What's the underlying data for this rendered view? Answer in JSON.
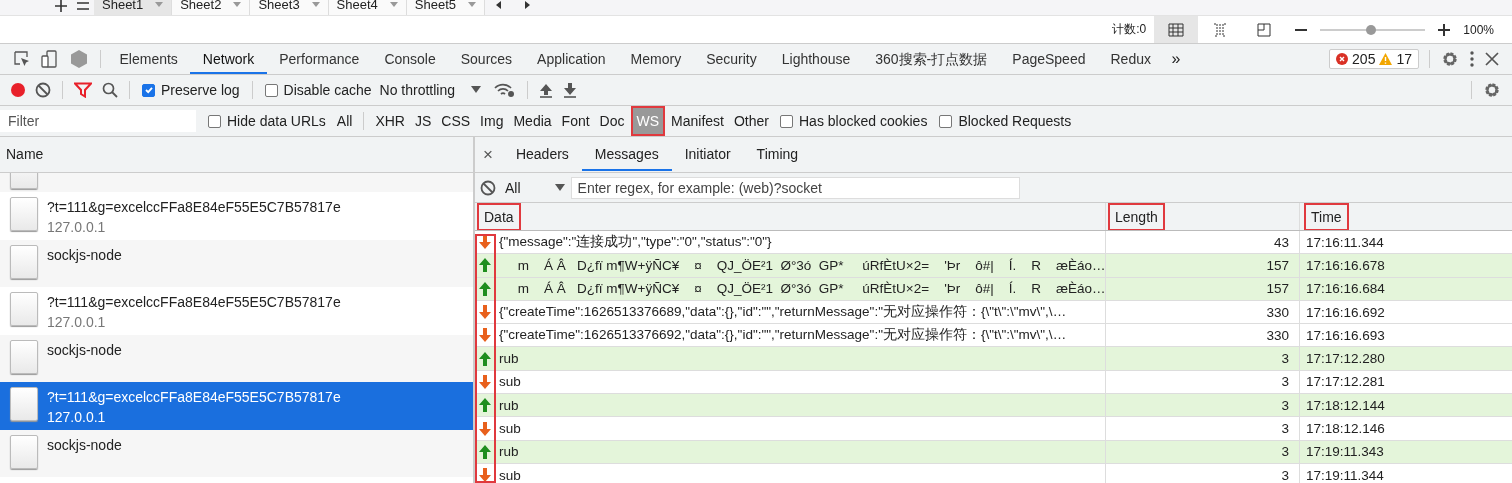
{
  "spreadsheet": {
    "sheet_tabs": [
      {
        "label": "Sheet1",
        "selected": true
      },
      {
        "label": "Sheet2",
        "selected": false
      },
      {
        "label": "Sheet3",
        "selected": false
      },
      {
        "label": "Sheet4",
        "selected": false
      },
      {
        "label": "Sheet5",
        "selected": false
      }
    ],
    "count": "计数:0",
    "views": [
      {
        "selected": true
      },
      {
        "selected": false
      },
      {
        "selected": false
      }
    ],
    "zoom": {
      "level": 0.48,
      "reading": "100%"
    }
  },
  "devtools": {
    "tabs": [
      {
        "label": "Elements",
        "selected": false
      },
      {
        "label": "Network",
        "selected": true
      },
      {
        "label": "Performance",
        "selected": false
      },
      {
        "label": "Console",
        "selected": false
      },
      {
        "label": "Sources",
        "selected": false
      },
      {
        "label": "Application",
        "selected": false
      },
      {
        "label": "Memory",
        "selected": false
      },
      {
        "label": "Security",
        "selected": false
      },
      {
        "label": "Lighthouse",
        "selected": false
      },
      {
        "label": "360搜索-打点数据",
        "selected": false
      },
      {
        "label": "PageSpeed",
        "selected": false
      },
      {
        "label": "Redux",
        "selected": false
      }
    ],
    "more": "»",
    "issues": {
      "errors": "205",
      "warnings": "17"
    },
    "toolbar": {
      "preserve_log": {
        "label": "Preserve log",
        "checked": true
      },
      "disable_cache": {
        "label": "Disable cache",
        "checked": false
      },
      "throttling": "No throttling"
    },
    "filter": {
      "placeholder": "Filter",
      "hide_data_urls": {
        "label": "Hide data URLs",
        "checked": false
      },
      "types": [
        {
          "label": "All",
          "selected": false,
          "annotated": false
        },
        {
          "label": "XHR",
          "selected": false,
          "annotated": false
        },
        {
          "label": "JS",
          "selected": false,
          "annotated": false
        },
        {
          "label": "CSS",
          "selected": false,
          "annotated": false
        },
        {
          "label": "Img",
          "selected": false,
          "annotated": false
        },
        {
          "label": "Media",
          "selected": false,
          "annotated": false
        },
        {
          "label": "Font",
          "selected": false,
          "annotated": false
        },
        {
          "label": "Doc",
          "selected": false,
          "annotated": false
        },
        {
          "label": "WS",
          "selected": true,
          "annotated": true
        },
        {
          "label": "Manifest",
          "selected": false,
          "annotated": false
        },
        {
          "label": "Other",
          "selected": false,
          "annotated": false
        }
      ],
      "has_blocked_cookies": {
        "label": "Has blocked cookies",
        "checked": false
      },
      "blocked_requests": {
        "label": "Blocked Requests",
        "checked": false
      }
    },
    "requests": {
      "column": "Name",
      "rows": [
        {
          "name": "?t=111&g=excelccFFa8E84eF55E5C7B57817e",
          "host": "127.0.0.1",
          "selected": false
        },
        {
          "name": "sockjs-node",
          "selected": false
        },
        {
          "name": "?t=111&g=excelccFFa8E84eF55E5C7B57817e",
          "host": "127.0.0.1",
          "selected": false
        },
        {
          "name": "sockjs-node",
          "selected": false
        },
        {
          "name": "?t=111&g=excelccFFa8E84eF55E5C7B57817e",
          "host": "127.0.0.1",
          "selected": true
        },
        {
          "name": "sockjs-node",
          "selected": false
        }
      ]
    },
    "detail": {
      "close": "×",
      "tabs": [
        {
          "label": "Headers",
          "selected": false
        },
        {
          "label": "Messages",
          "selected": true
        },
        {
          "label": "Initiator",
          "selected": false
        },
        {
          "label": "Timing",
          "selected": false
        }
      ],
      "message_filter": {
        "type": "All",
        "placeholder": "Enter regex, for example: (web)?socket"
      },
      "columns": [
        {
          "label": "Data",
          "annotated": true
        },
        {
          "label": "Length",
          "annotated": true
        },
        {
          "label": "Time",
          "annotated": true
        }
      ],
      "direction_annotated": true,
      "messages": [
        {
          "sent": false,
          "data": "{\"message\":\"连接成功\",\"type\":\"0\",\"status\":\"0\"}",
          "length": "43",
          "time": "17:16:11.344"
        },
        {
          "sent": true,
          "data": "     m    Á Â   D¿fï m¶W+ÿÑC¥    ¤    QJ_ÖE²1  Ø°3ó  GP*     úRfÈtU×2=    'Þr    ô#|    Í.    R    æÈáo…",
          "length": "157",
          "time": "17:16:16.678"
        },
        {
          "sent": true,
          "data": "     m    Á Â   D¿fï m¶W+ÿÑC¥    ¤    QJ_ÖE²1  Ø°3ó  GP*     úRfÈtU×2=    'Þr    ô#|    Í.    R    æÈáo…",
          "length": "157",
          "time": "17:16:16.684"
        },
        {
          "sent": false,
          "data": "{\"createTime\":1626513376689,\"data\":{},\"id\":\"\",\"returnMessage\":\"无对应操作符：{\\\"t\\\":\\\"mv\\\",\\…",
          "length": "330",
          "time": "17:16:16.692"
        },
        {
          "sent": false,
          "data": "{\"createTime\":1626513376692,\"data\":{},\"id\":\"\",\"returnMessage\":\"无对应操作符：{\\\"t\\\":\\\"mv\\\",\\…",
          "length": "330",
          "time": "17:16:16.693"
        },
        {
          "sent": true,
          "data": "rub",
          "length": "3",
          "time": "17:17:12.280"
        },
        {
          "sent": false,
          "data": "sub",
          "length": "3",
          "time": "17:17:12.281"
        },
        {
          "sent": true,
          "data": "rub",
          "length": "3",
          "time": "17:18:12.144"
        },
        {
          "sent": false,
          "data": "sub",
          "length": "3",
          "time": "17:18:12.146"
        },
        {
          "sent": true,
          "data": "rub",
          "length": "3",
          "time": "17:19:11.343"
        },
        {
          "sent": false,
          "data": "sub",
          "length": "3",
          "time": "17:19:11.344"
        }
      ]
    }
  }
}
